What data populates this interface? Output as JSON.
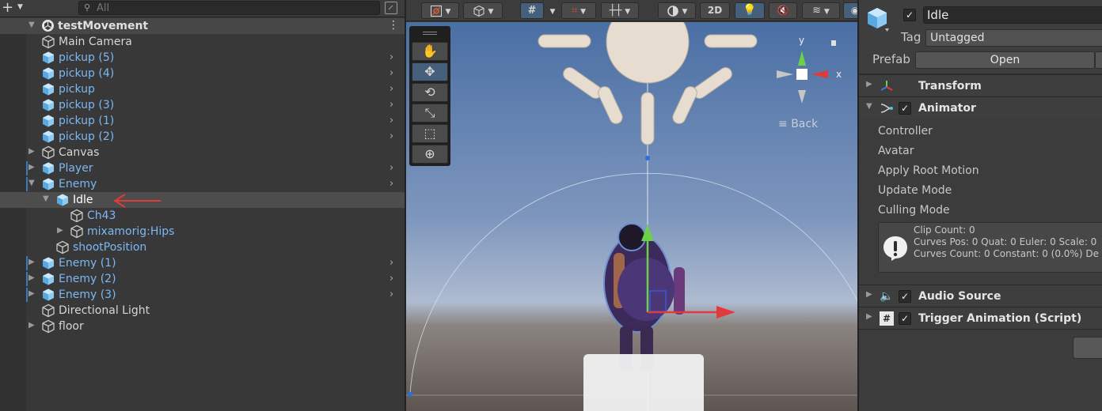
{
  "hierarchy": {
    "add_label": "+",
    "search_placeholder": "All",
    "scene_name": "testMovement",
    "items": [
      {
        "label": "Main Camera",
        "color": "white",
        "depth": 1,
        "expander": "none",
        "kind": "object",
        "chevron": false,
        "mark": false
      },
      {
        "label": "pickup (5)",
        "color": "blue",
        "depth": 1,
        "expander": "none",
        "kind": "prefab",
        "chevron": true,
        "mark": false
      },
      {
        "label": "pickup (4)",
        "color": "blue",
        "depth": 1,
        "expander": "none",
        "kind": "prefab",
        "chevron": true,
        "mark": false
      },
      {
        "label": "pickup",
        "color": "blue",
        "depth": 1,
        "expander": "none",
        "kind": "prefab",
        "chevron": true,
        "mark": false
      },
      {
        "label": "pickup (3)",
        "color": "blue",
        "depth": 1,
        "expander": "none",
        "kind": "prefab",
        "chevron": true,
        "mark": false
      },
      {
        "label": "pickup (1)",
        "color": "blue",
        "depth": 1,
        "expander": "none",
        "kind": "prefab",
        "chevron": true,
        "mark": false
      },
      {
        "label": "pickup (2)",
        "color": "blue",
        "depth": 1,
        "expander": "none",
        "kind": "prefab",
        "chevron": true,
        "mark": false
      },
      {
        "label": "Canvas",
        "color": "white",
        "depth": 1,
        "expander": "collapsed",
        "kind": "object",
        "chevron": false,
        "mark": false
      },
      {
        "label": "Player",
        "color": "blue",
        "depth": 1,
        "expander": "collapsed",
        "kind": "prefab",
        "chevron": true,
        "mark": true
      },
      {
        "label": "Enemy",
        "color": "blue",
        "depth": 1,
        "expander": "expanded",
        "kind": "prefab",
        "chevron": true,
        "mark": true
      },
      {
        "label": "Idle",
        "color": "selected",
        "depth": 2,
        "expander": "expanded",
        "kind": "prefab",
        "chevron": false,
        "mark": false,
        "selected": true
      },
      {
        "label": "Ch43",
        "color": "blue",
        "depth": 3,
        "expander": "none",
        "kind": "object",
        "chevron": false,
        "mark": false
      },
      {
        "label": "mixamorig:Hips",
        "color": "blue",
        "depth": 3,
        "expander": "collapsed",
        "kind": "object",
        "chevron": false,
        "mark": false
      },
      {
        "label": "shootPosition",
        "color": "blue",
        "depth": 2,
        "expander": "none",
        "kind": "object",
        "chevron": false,
        "mark": false
      },
      {
        "label": "Enemy (1)",
        "color": "blue",
        "depth": 1,
        "expander": "collapsed",
        "kind": "prefab",
        "chevron": true,
        "mark": true
      },
      {
        "label": "Enemy (2)",
        "color": "blue",
        "depth": 1,
        "expander": "collapsed",
        "kind": "prefab",
        "chevron": true,
        "mark": true
      },
      {
        "label": "Enemy (3)",
        "color": "blue",
        "depth": 1,
        "expander": "collapsed",
        "kind": "prefab",
        "chevron": true,
        "mark": true
      },
      {
        "label": "Directional Light",
        "color": "white",
        "depth": 1,
        "expander": "none",
        "kind": "object",
        "chevron": false,
        "mark": false
      },
      {
        "label": "floor",
        "color": "white",
        "depth": 1,
        "expander": "collapsed",
        "kind": "object",
        "chevron": false,
        "mark": false
      }
    ]
  },
  "scene_view": {
    "toolbar_2d_label": "2D",
    "gizmo": {
      "y_label": "y",
      "x_label": "x",
      "back_label": "Back"
    },
    "tools": [
      "hand-tool",
      "move-tool",
      "rotate-tool",
      "scale-tool",
      "rect-tool",
      "transform-tool"
    ],
    "active_tool": "move-tool"
  },
  "inspector": {
    "object_name": "Idle",
    "active": true,
    "tag_label": "Tag",
    "tag_value": "Untagged",
    "prefab_label": "Prefab",
    "open_label": "Open",
    "components": {
      "transform": "Transform",
      "animator": "Animator",
      "audio_source": "Audio Source",
      "trigger_animation": "Trigger Animation (Script)"
    },
    "animator_props": [
      "Controller",
      "Avatar",
      "Apply Root Motion",
      "Update Mode",
      "Culling Mode"
    ],
    "animator_info": [
      "Clip Count: 0",
      "Curves Pos: 0 Quat: 0 Euler: 0 Scale: 0",
      "Curves Count: 0 Constant: 0 (0.0%) De"
    ]
  },
  "colors": {
    "prefab_blue": "#7cb8f5",
    "selection_bg": "#4d4d4d",
    "active_tool": "#46607c",
    "annotation_red": "#e23a3a"
  }
}
